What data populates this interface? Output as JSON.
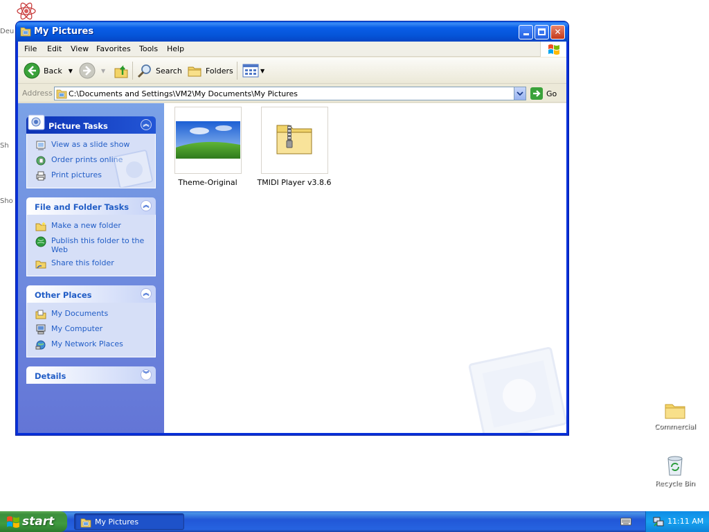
{
  "desktop": {
    "icons": [
      {
        "label": "Commercial"
      },
      {
        "label": "Recycle Bin"
      }
    ]
  },
  "window": {
    "title": "My Pictures",
    "menu": [
      "File",
      "Edit",
      "View",
      "Favorites",
      "Tools",
      "Help"
    ],
    "toolbar": {
      "back": "Back",
      "search": "Search",
      "folders": "Folders"
    },
    "address": {
      "label": "Address",
      "value": "C:\\Documents and Settings\\VM2\\My Documents\\My Pictures",
      "go": "Go"
    },
    "taskpane": {
      "picture_tasks": {
        "title": "Picture Tasks",
        "items": [
          "View as a slide show",
          "Order prints online",
          "Print pictures"
        ]
      },
      "file_folder_tasks": {
        "title": "File and Folder Tasks",
        "items": [
          "Make a new folder",
          "Publish this folder to the Web",
          "Share this folder"
        ]
      },
      "other_places": {
        "title": "Other Places",
        "items": [
          "My Documents",
          "My Computer",
          "My Network Places"
        ]
      },
      "details": {
        "title": "Details"
      }
    },
    "files": [
      {
        "name": "Theme-Original",
        "icon": "image-thumbnail-icon"
      },
      {
        "name": "TMIDI Player v3.8.6",
        "icon": "zip-folder-icon"
      }
    ]
  },
  "taskbar": {
    "start": "start",
    "task_button": "My Pictures",
    "clock": "11:11 AM"
  },
  "colors": {
    "title_blue": "#0a5fe8",
    "taskpane_link": "#215dc6",
    "start_green": "#3c8f3c",
    "tray_blue": "#18a2f0"
  }
}
